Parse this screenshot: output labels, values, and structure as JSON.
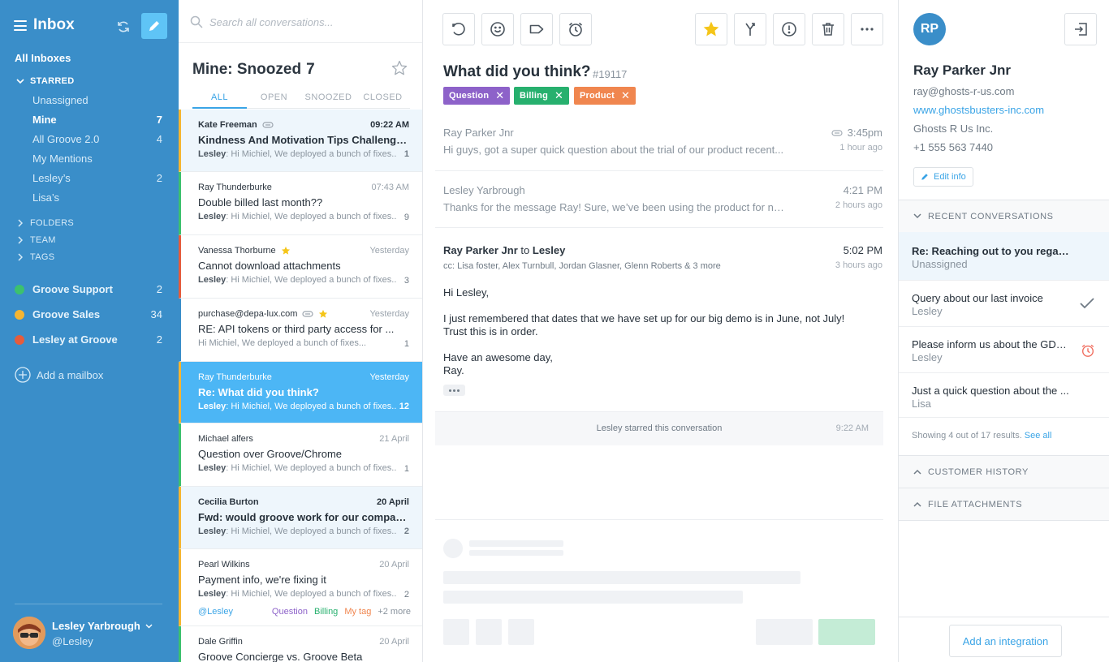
{
  "sidebar": {
    "title": "Inbox",
    "all_inboxes": "All Inboxes",
    "starred_label": "STARRED",
    "starred_items": [
      {
        "label": "Unassigned",
        "count": ""
      },
      {
        "label": "Mine",
        "count": "7"
      },
      {
        "label": "All Groove 2.0",
        "count": "4"
      },
      {
        "label": "My Mentions",
        "count": ""
      },
      {
        "label": "Lesley’s",
        "count": "2"
      },
      {
        "label": "Lisa’s",
        "count": ""
      }
    ],
    "sections": [
      "FOLDERS",
      "TEAM",
      "TAGS"
    ],
    "mailboxes": [
      {
        "label": "Groove Support",
        "count": "2",
        "color": "#3cc16e"
      },
      {
        "label": "Groove Sales",
        "count": "34",
        "color": "#f5b531"
      },
      {
        "label": "Lesley at Groove",
        "count": "2",
        "color": "#e55c3c"
      }
    ],
    "add_mailbox": "Add a mailbox",
    "user": {
      "name": "Lesley Yarbrough",
      "handle": "@Lesley"
    }
  },
  "list": {
    "search_placeholder": "Search all conversations...",
    "folder_title": "Mine: Snoozed",
    "folder_count": "7",
    "tabs": [
      "ALL",
      "OPEN",
      "SNOOZED",
      "CLOSED"
    ],
    "conversations": [
      {
        "from": "Kate Freeman",
        "time": "09:22 AM",
        "subject": "Kindness And Motivation Tips Challenge to...",
        "snippet_author": "Lesley",
        "snippet": ": Hi Michiel, We deployed a bunch of fixes...",
        "count": "1"
      },
      {
        "from": "Ray Thunderburke",
        "time": "07:43 AM",
        "subject": "Double billed last month??",
        "snippet_author": "Lesley",
        "snippet": ": Hi Michiel, We deployed a bunch of fixes...",
        "count": "9"
      },
      {
        "from": "Vanessa Thorburne",
        "time": "Yesterday",
        "subject": "Cannot download attachments",
        "snippet_author": "Lesley",
        "snippet": ": Hi Michiel, We deployed a bunch of fixes...",
        "count": "3"
      },
      {
        "from": "purchase@depa-lux.com",
        "time": "Yesterday",
        "subject": "RE: API tokens or third party access for ...",
        "snippet_author": "",
        "snippet": "Hi Michiel, We deployed a bunch of fixes...",
        "count": "1"
      },
      {
        "from": "Ray Thunderburke",
        "time": "Yesterday",
        "subject": "Re: What did you think?",
        "snippet_author": "Lesley",
        "snippet": ": Hi Michiel, We deployed a bunch of fixes...",
        "count": "12"
      },
      {
        "from": "Michael alfers",
        "time": "21 April",
        "subject": "Question over Groove/Chrome",
        "snippet_author": "Lesley",
        "snippet": ": Hi Michiel, We deployed a bunch of fixes...",
        "count": "1"
      },
      {
        "from": "Cecilia Burton",
        "time": "20 April",
        "subject": "Fwd: would groove work for our company ...",
        "snippet_author": "Lesley",
        "snippet": ": Hi Michiel, We deployed a bunch of fixes...",
        "count": "2"
      },
      {
        "from": "Pearl Wilkins",
        "time": "20 April",
        "subject": "Payment info, we're fixing it",
        "snippet_author": "Lesley",
        "snippet": ": Hi Michiel, We deployed a bunch of fixes...",
        "count": "2",
        "mention": "@Lesley",
        "tags": [
          "Question",
          "Billing",
          "My tag",
          "+2 more"
        ]
      },
      {
        "from": "Dale Griffin",
        "time": "20 April",
        "subject": "Groove Concierge vs. Groove Beta",
        "snippet_author": "",
        "snippet": "",
        "count": ""
      }
    ]
  },
  "conversation": {
    "title": "What did you think?",
    "number": "#19117",
    "tags": [
      {
        "label": "Question",
        "color": "#8d62c9"
      },
      {
        "label": "Billing",
        "color": "#27b06e"
      },
      {
        "label": "Product",
        "color": "#f0864f"
      }
    ],
    "messages": [
      {
        "author": "Ray Parker Jnr",
        "time": "3:45pm",
        "ago": "1 hour ago",
        "preview": "Hi guys, got a super quick question about the trial of our product recent..."
      },
      {
        "author": "Lesley Yarbrough",
        "time": "4:21 PM",
        "ago": "2 hours ago",
        "preview": "Thanks for the message Ray! Sure, we’ve been using the product for nea..."
      }
    ],
    "open_message": {
      "from": "Ray Parker Jnr",
      "to_word": "to",
      "to": "Lesley",
      "time": "5:02 PM",
      "ago": "3 hours ago",
      "cc": "cc: Lisa foster, Alex Turnbull, Jordan Glasner, Glenn Roberts & 3 more",
      "greeting": "Hi Lesley,",
      "line1": "I just remembered that dates that we have set up for our big demo is in June, not July!",
      "line2": "Trust this is in order.",
      "sign1": "Have an awesome day,",
      "sign2": "Ray."
    },
    "event": {
      "text": "Lesley starred this conversation",
      "time": "9:22 AM"
    }
  },
  "customer": {
    "initials": "RP",
    "name": "Ray Parker Jnr",
    "email": "ray@ghosts-r-us.com",
    "website": "www.ghostsbusters-inc.com",
    "company": "Ghosts R Us Inc.",
    "phone": "+1 555 563 7440",
    "edit_info": "Edit info",
    "recent_label": "RECENT CONVERSATIONS",
    "recent": [
      {
        "title": "Re: Reaching out to you regarding...",
        "sub": "Unassigned"
      },
      {
        "title": "Query about our last invoice",
        "sub": "Lesley"
      },
      {
        "title": "Please inform us about the GDPR...",
        "sub": "Lesley"
      },
      {
        "title": "Just a quick question about the ...",
        "sub": "Lisa"
      }
    ],
    "showing": "Showing 4 out of 17 results.",
    "see_all": "See all",
    "history_label": "CUSTOMER HISTORY",
    "files_label": "FILE ATTACHMENTS",
    "add_integration": "Add an integration"
  },
  "colors": {
    "sidebar": "#3a8ec9",
    "accent": "#3aa4e6",
    "selected_row": "#4cb6f5",
    "star": "#f5c518"
  }
}
